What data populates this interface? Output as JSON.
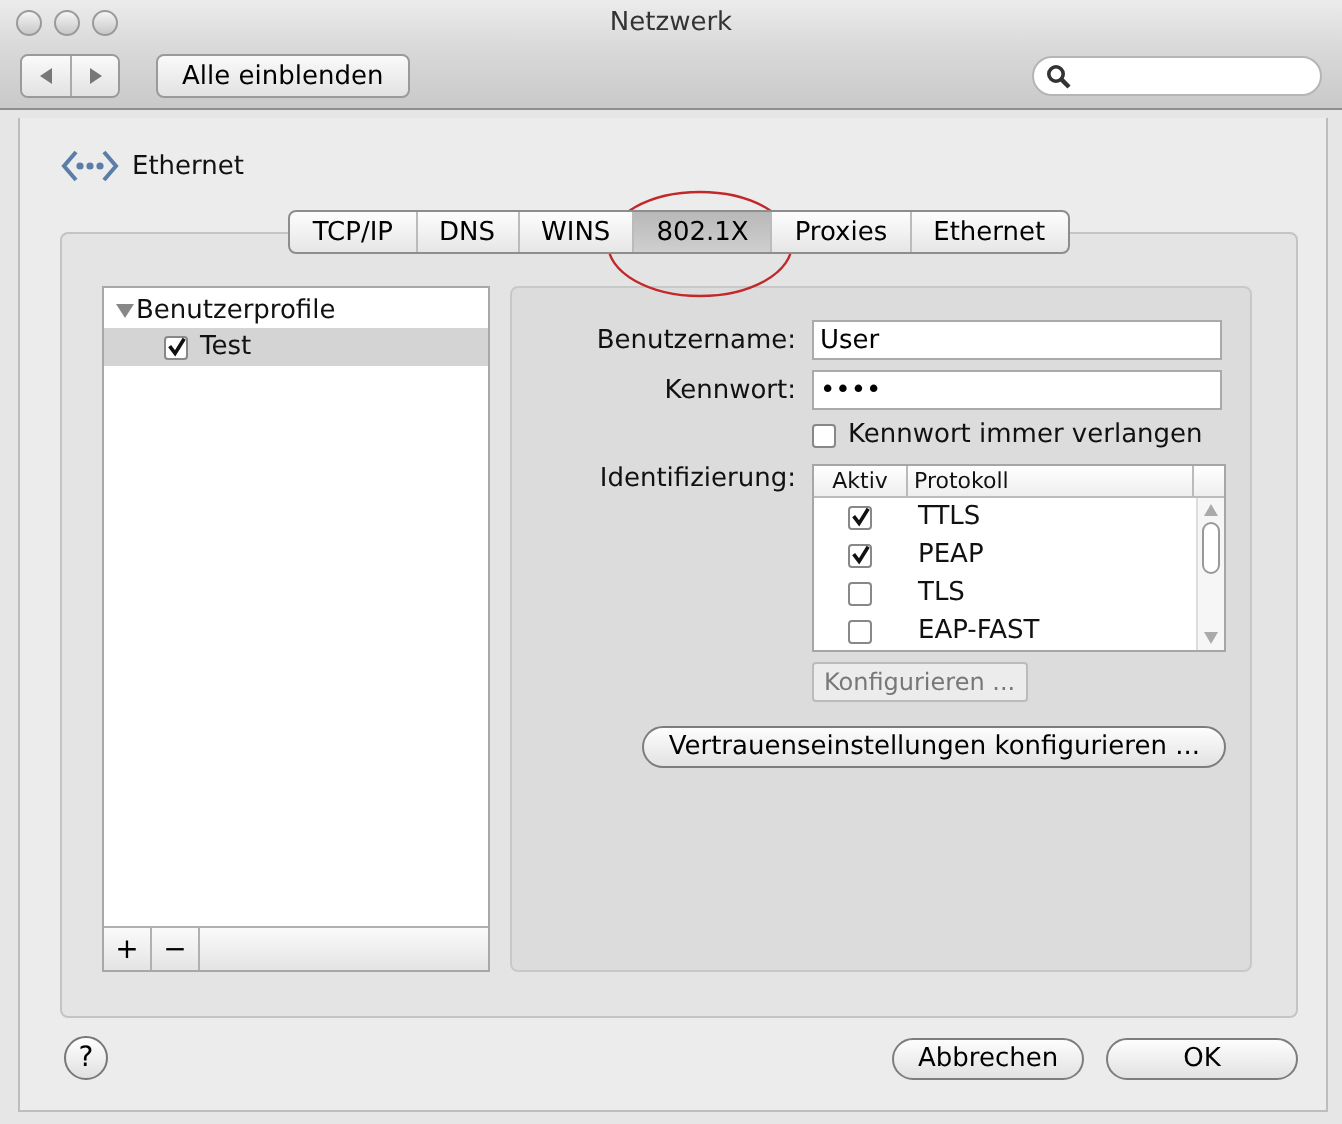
{
  "window": {
    "title": "Netzwerk"
  },
  "toolbar": {
    "show_all": "Alle einblenden"
  },
  "service": {
    "name": "Ethernet"
  },
  "tabs": [
    {
      "label": "TCP/IP",
      "selected": false
    },
    {
      "label": "DNS",
      "selected": false
    },
    {
      "label": "WINS",
      "selected": false
    },
    {
      "label": "802.1X",
      "selected": true
    },
    {
      "label": "Proxies",
      "selected": false
    },
    {
      "label": "Ethernet",
      "selected": false
    }
  ],
  "profiles": {
    "header": "Benutzerprofile",
    "expanded": true,
    "items": [
      {
        "label": "Test",
        "checked": true,
        "selected": true
      }
    ]
  },
  "list_buttons": [
    "+",
    "−"
  ],
  "form": {
    "username_label": "Benutzername:",
    "username": "User",
    "password_label": "Kennwort:",
    "password": "••••",
    "always_ask": {
      "label": "Kennwort immer verlangen",
      "checked": false
    },
    "auth_label": "Identifizierung:",
    "columns": [
      "Aktiv",
      "Protokoll"
    ],
    "protocols": [
      {
        "name": "TTLS",
        "checked": true
      },
      {
        "name": "PEAP",
        "checked": true
      },
      {
        "name": "TLS",
        "checked": false
      },
      {
        "name": "EAP-FAST",
        "checked": false
      }
    ],
    "configure": {
      "label": "Konfigurieren ...",
      "disabled": true
    },
    "trust_button": "Vertrauenseinstellungen konfigurieren ..."
  },
  "help": "?",
  "buttons": [
    "Abbrechen",
    "OK"
  ]
}
